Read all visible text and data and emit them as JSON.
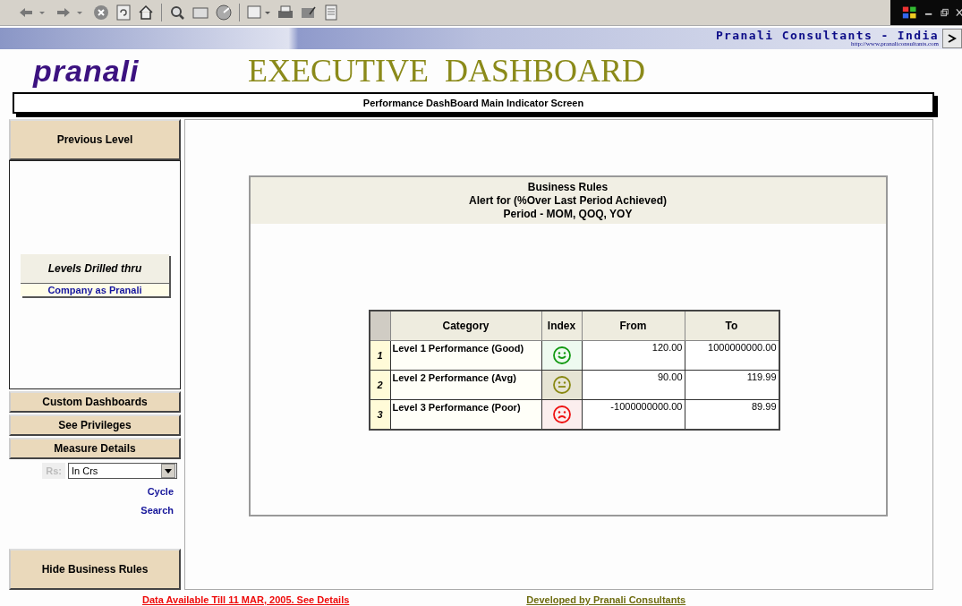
{
  "brand": {
    "name": "Pranali Consultants - India",
    "url": "http://www.pranaliconsultants.com"
  },
  "logo": "pranali",
  "title": "EXECUTIVE  DASHBOARD",
  "subtitle": "Performance DashBoard Main Indicator Screen",
  "sidebar": {
    "previous_level": "Previous Level",
    "levels_drilled": {
      "title": "Levels Drilled thru",
      "items": [
        "Company as Pranali"
      ]
    },
    "buttons": [
      "Custom Dashboards",
      "See Privileges",
      "Measure Details"
    ],
    "currency": {
      "label": "Rs:",
      "value": "In Crs"
    },
    "links": [
      "Cycle",
      "Search"
    ],
    "hide_button": "Hide Business Rules"
  },
  "rules": {
    "title_lines": [
      "Business Rules",
      "Alert for (%Over Last Period Achieved)",
      "Period - MOM, QOQ, YOY"
    ],
    "columns": [
      "Category",
      "Index",
      "From",
      "To"
    ],
    "rows": [
      {
        "number": "1",
        "category": "Level 1 Performance (Good)",
        "kind": "good",
        "color": "#119911",
        "from": "120.00",
        "to": "1000000000.00"
      },
      {
        "number": "2",
        "category": "Level 2 Performance (Avg)",
        "kind": "avg",
        "color": "#888811",
        "from": "90.00",
        "to": "119.99"
      },
      {
        "number": "3",
        "category": "Level 3 Performance (Poor)",
        "kind": "poor",
        "color": "#ee1111",
        "from": "-1000000000.00",
        "to": "89.99"
      }
    ]
  },
  "footer": {
    "data_link": "Data Available Till 11 MAR, 2005. See Details",
    "credit_link": "Developed by Pranali Consultants"
  }
}
